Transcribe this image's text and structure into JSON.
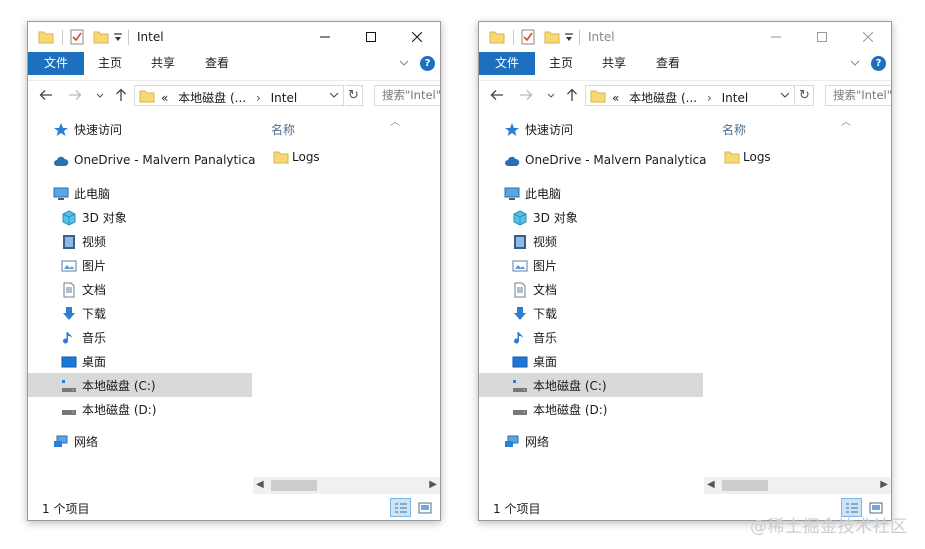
{
  "windows": [
    {
      "title": "Intel",
      "ribbon": {
        "file": "文件",
        "home": "主页",
        "share": "共享",
        "view": "查看",
        "help": "?"
      },
      "address": {
        "overflow": "«",
        "crumbs": [
          "本地磁盘 (...",
          "Intel"
        ],
        "search_placeholder": "搜索\"Intel\""
      },
      "nav": [
        {
          "label": "快速访问",
          "icon": "star-icon"
        },
        {
          "label": "OneDrive - Malvern Panalytica",
          "icon": "cloud-icon"
        },
        {
          "label": "此电脑",
          "icon": "computer-icon"
        },
        {
          "label": "3D 对象",
          "icon": "cube-icon"
        },
        {
          "label": "视频",
          "icon": "video-icon"
        },
        {
          "label": "图片",
          "icon": "picture-icon"
        },
        {
          "label": "文档",
          "icon": "document-icon"
        },
        {
          "label": "下载",
          "icon": "download-icon"
        },
        {
          "label": "音乐",
          "icon": "music-icon"
        },
        {
          "label": "桌面",
          "icon": "desktop-icon"
        },
        {
          "label": "本地磁盘 (C:)",
          "icon": "drive-c-icon",
          "selected": true
        },
        {
          "label": "本地磁盘 (D:)",
          "icon": "drive-d-icon"
        },
        {
          "label": "网络",
          "icon": "network-icon"
        }
      ],
      "column_header": "名称",
      "files": [
        {
          "name": "Logs",
          "icon": "folder-icon"
        }
      ],
      "status": "1 个项目"
    },
    {
      "title": "Intel",
      "ribbon": {
        "file": "文件",
        "home": "主页",
        "share": "共享",
        "view": "查看",
        "help": "?"
      },
      "address": {
        "overflow": "«",
        "crumbs": [
          "本地磁盘 (...",
          "Intel"
        ],
        "search_placeholder": "搜索\"Intel\""
      },
      "nav": [
        {
          "label": "快速访问",
          "icon": "star-icon"
        },
        {
          "label": "OneDrive - Malvern Panalytica",
          "icon": "cloud-icon"
        },
        {
          "label": "此电脑",
          "icon": "computer-icon"
        },
        {
          "label": "3D 对象",
          "icon": "cube-icon"
        },
        {
          "label": "视频",
          "icon": "video-icon"
        },
        {
          "label": "图片",
          "icon": "picture-icon"
        },
        {
          "label": "文档",
          "icon": "document-icon"
        },
        {
          "label": "下载",
          "icon": "download-icon"
        },
        {
          "label": "音乐",
          "icon": "music-icon"
        },
        {
          "label": "桌面",
          "icon": "desktop-icon"
        },
        {
          "label": "本地磁盘 (C:)",
          "icon": "drive-c-icon",
          "selected": true
        },
        {
          "label": "本地磁盘 (D:)",
          "icon": "drive-d-icon"
        },
        {
          "label": "网络",
          "icon": "network-icon"
        }
      ],
      "column_header": "名称",
      "files": [
        {
          "name": "Logs",
          "icon": "folder-icon"
        }
      ],
      "status": "1 个项目"
    }
  ],
  "watermark": "@稀土掘金技术社区",
  "colors": {
    "accent": "#1f6fbf",
    "selection": "#d9d9d9",
    "folder": "#f8d775"
  }
}
